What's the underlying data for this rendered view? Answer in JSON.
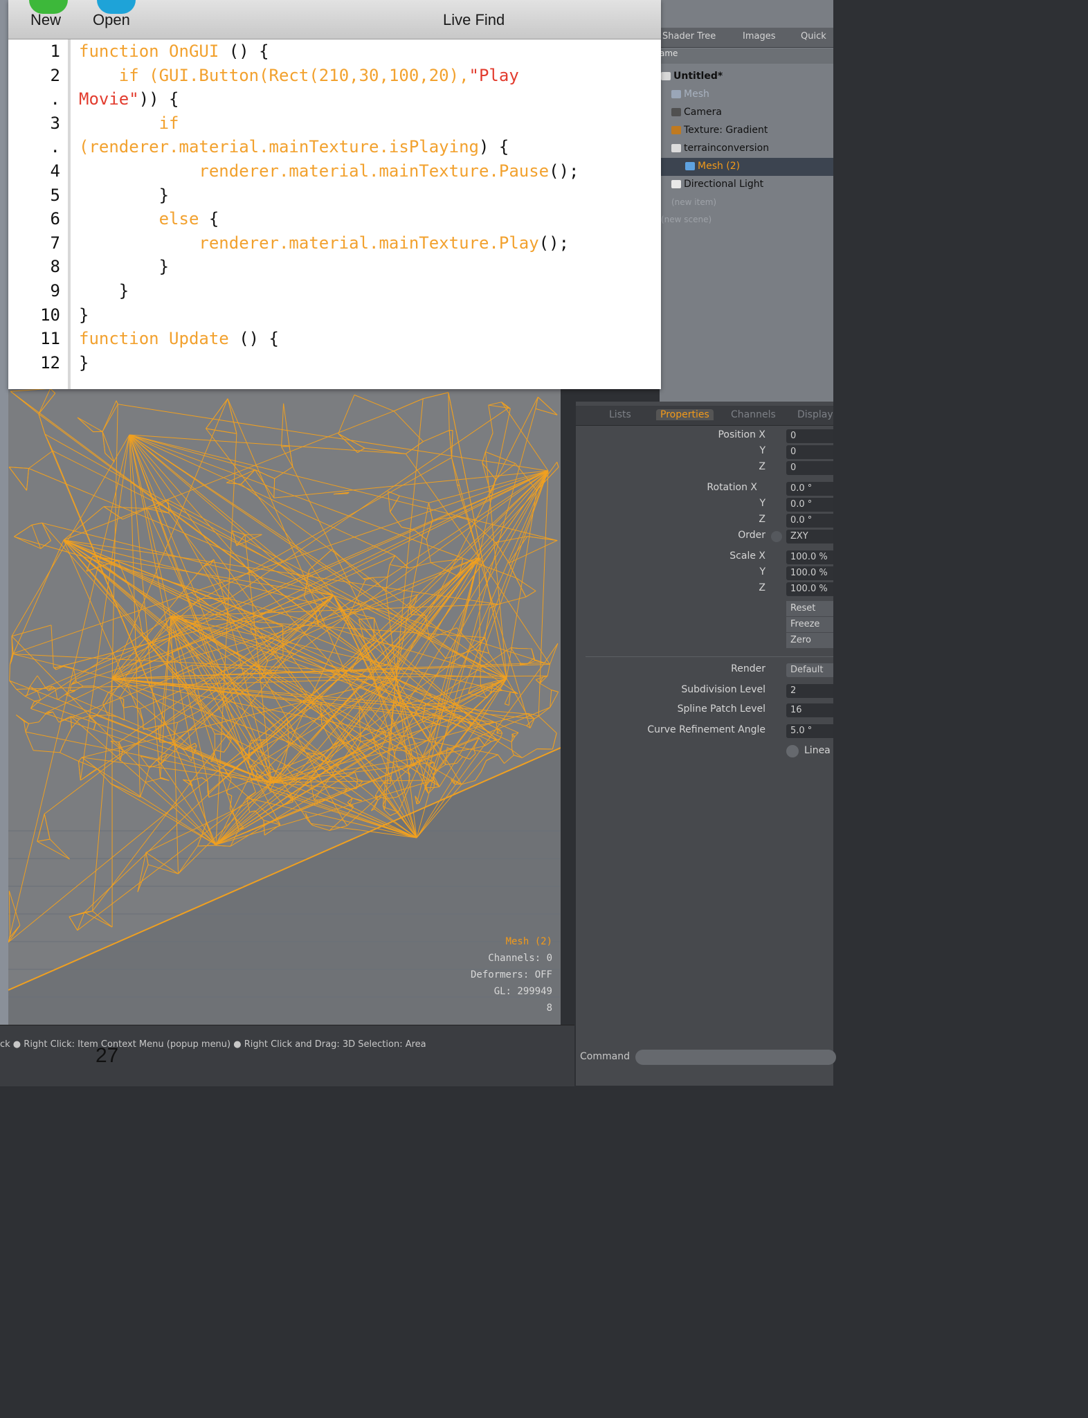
{
  "editor": {
    "toolbar": {
      "new_label": "New",
      "open_label": "Open",
      "live_find_label": "Live Find"
    },
    "line_numbers": [
      "1",
      "2",
      ".",
      "3",
      ".",
      "4",
      "5",
      "6",
      "7",
      "8",
      "9",
      "10",
      "11",
      "12"
    ],
    "lines": [
      [
        {
          "t": "function OnGUI",
          "c": "kw"
        },
        {
          "t": " () {",
          "c": ""
        }
      ],
      [
        {
          "t": "    if (GUI.Button(Rect",
          "c": "kw"
        },
        {
          "t": "(210,30,100,20),",
          "c": "kw"
        },
        {
          "t": "\"Play",
          "c": "str"
        }
      ],
      [
        {
          "t": "Movie\"",
          "c": "str"
        },
        {
          "t": ")) {",
          "c": ""
        }
      ],
      [
        {
          "t": "        if",
          "c": "kw"
        }
      ],
      [
        {
          "t": "(renderer.material.mainTexture.isPlaying",
          "c": "kw"
        },
        {
          "t": ") {",
          "c": ""
        }
      ],
      [
        {
          "t": "            renderer.material.mainTexture.Pause",
          "c": "kw"
        },
        {
          "t": "();",
          "c": ""
        }
      ],
      [
        {
          "t": "        }",
          "c": ""
        }
      ],
      [
        {
          "t": "        else",
          "c": "kw"
        },
        {
          "t": " {",
          "c": ""
        }
      ],
      [
        {
          "t": "            renderer.material.mainTexture.Play",
          "c": "kw"
        },
        {
          "t": "();",
          "c": ""
        }
      ],
      [
        {
          "t": "        }",
          "c": ""
        }
      ],
      [
        {
          "t": "    }",
          "c": ""
        }
      ],
      [
        {
          "t": "}",
          "c": ""
        }
      ],
      [
        {
          "t": "function Update",
          "c": "kw"
        },
        {
          "t": " () {",
          "c": ""
        }
      ],
      [
        {
          "t": "}",
          "c": ""
        }
      ]
    ]
  },
  "right_panel": {
    "tabs": [
      "Shader Tree",
      "Images",
      "Quick"
    ],
    "tree_header": "ame",
    "items": [
      {
        "label": "Untitled*",
        "color": "#d8d8d8"
      },
      {
        "label": "Mesh",
        "color": "#9aa6b8"
      },
      {
        "label": "Camera",
        "color": "#505050"
      },
      {
        "label": "Texture: Gradient",
        "color": "#c07a20"
      },
      {
        "label": "terrainconversion",
        "color": "#dcdcdc"
      },
      {
        "label": "Mesh (2)",
        "color": "#5ea2e0"
      },
      {
        "label": "Directional Light",
        "color": "#e8e8e8"
      },
      {
        "label": "(new item)",
        "color": ""
      },
      {
        "label": "(new scene)",
        "color": ""
      }
    ]
  },
  "properties": {
    "tabs": [
      "Lists",
      "Properties",
      "Channels",
      "Display"
    ],
    "position_label": "Position X",
    "rotation_label": "Rotation X",
    "scale_label": "Scale X",
    "y_label": "Y",
    "z_label": "Z",
    "order_label": "Order",
    "position": [
      "0",
      "0",
      "0"
    ],
    "rotation": [
      "0.0 °",
      "0.0 °",
      "0.0 °"
    ],
    "order": "ZXY",
    "scale": [
      "100.0 %",
      "100.0 %",
      "100.0 %"
    ],
    "buttons": [
      "Reset",
      "Freeze",
      "Zero"
    ],
    "render_label": "Render",
    "render_value": "Default",
    "subdivision_label": "Subdivision Level",
    "subdivision_value": "2",
    "spline_label": "Spline Patch Level",
    "spline_value": "16",
    "curve_label": "Curve Refinement Angle",
    "curve_value": "5.0 °",
    "linear_label": "Linea",
    "command_label": "Command"
  },
  "viewport": {
    "info": [
      "Mesh (2)",
      "Channels: 0",
      "Deformers: OFF",
      "GL: 299949",
      "8"
    ]
  },
  "status_bar": {
    "text": "ck ● Right Click: Item Context Menu (popup menu) ● Right Click and Drag: 3D Selection: Area",
    "page_number": "27"
  }
}
